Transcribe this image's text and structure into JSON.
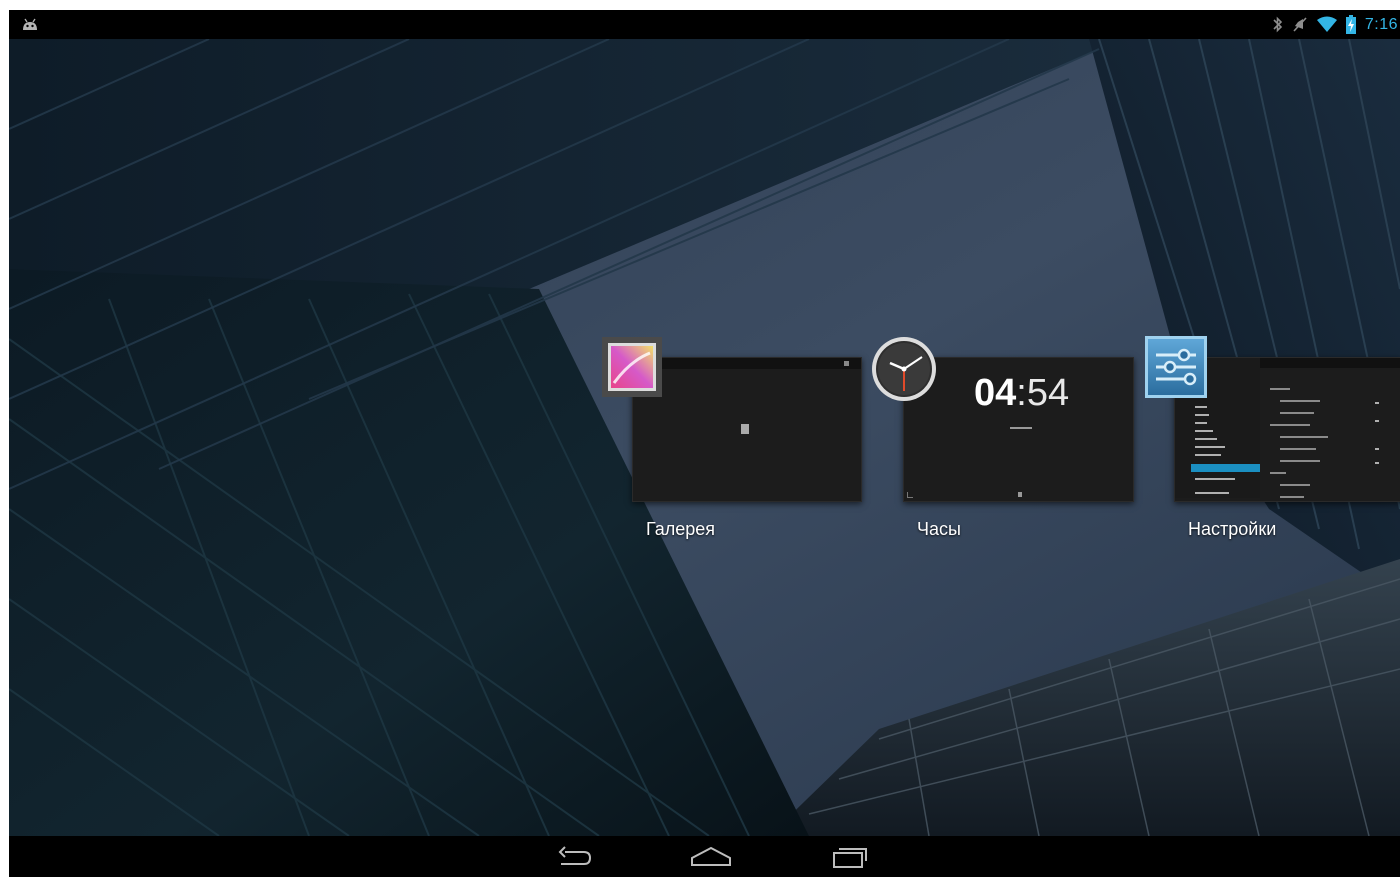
{
  "status_bar": {
    "time": "7:16",
    "accent_color": "#33b5e5",
    "icons": [
      "android-notification-icon",
      "bluetooth-icon",
      "mute-icon",
      "wifi-icon",
      "battery-charging-icon"
    ]
  },
  "recents": [
    {
      "label": "Галерея",
      "icon": "gallery-icon"
    },
    {
      "label": "Часы",
      "icon": "clock-icon",
      "thumb_time_hours": "04",
      "thumb_time_sep": ":",
      "thumb_time_minutes": "54"
    },
    {
      "label": "Настройки",
      "icon": "settings-icon"
    }
  ],
  "nav_bar": {
    "buttons": [
      "back-icon",
      "home-icon",
      "recent-apps-icon"
    ]
  }
}
